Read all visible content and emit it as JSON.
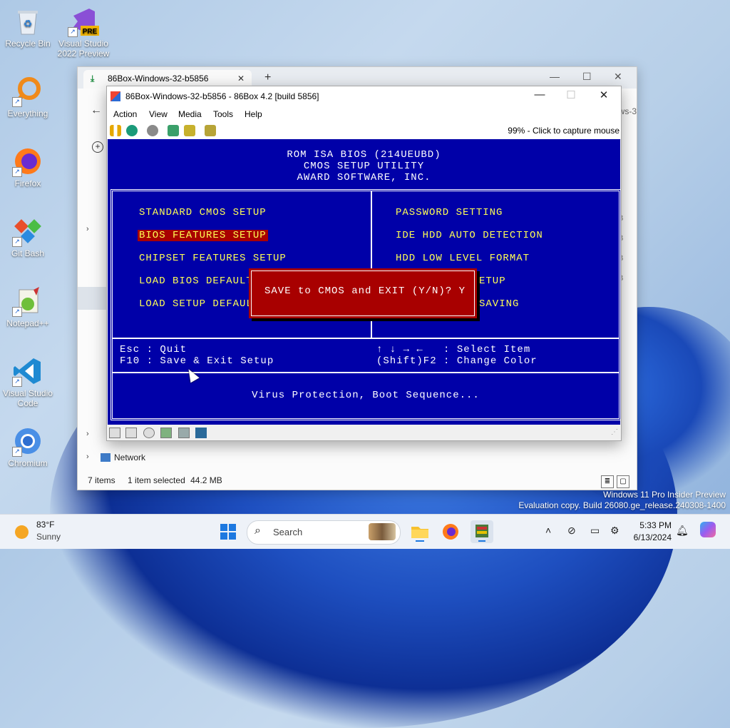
{
  "desktop": {
    "icons": [
      {
        "label": "Recycle Bin"
      },
      {
        "label": "Visual Studio 2022 Preview",
        "badge": "PRE"
      },
      {
        "label": "Everything"
      },
      {
        "label": "Firefox"
      },
      {
        "label": "Git Bash"
      },
      {
        "label": "Notepad++"
      },
      {
        "label": "Visual Studio Code"
      },
      {
        "label": "Chromium"
      }
    ],
    "watermark_line1": "Windows 11 Pro Insider Preview",
    "watermark_line2": "Evaluation copy. Build 26080.ge_release.240308-1400"
  },
  "explorer": {
    "tab_title": "86Box-Windows-32-b5856",
    "right_fragment": "ws-3",
    "network_label": "Network",
    "status_items": "7 items",
    "status_selected": "1 item selected",
    "status_size": "44.2 MB",
    "size_col": [
      "B",
      "B",
      "B",
      "B"
    ]
  },
  "box86": {
    "title": "86Box-Windows-32-b5856 - 86Box 4.2 [build 5856]",
    "menu": [
      "Action",
      "View",
      "Media",
      "Tools",
      "Help"
    ],
    "capture_hint": "99% - Click to capture mouse",
    "bios": {
      "header": [
        "ROM ISA BIOS (214UEUBD)",
        "CMOS SETUP UTILITY",
        "AWARD SOFTWARE, INC."
      ],
      "left_items": [
        "STANDARD CMOS SETUP",
        "BIOS FEATURES SETUP",
        "CHIPSET FEATURES SETUP",
        "LOAD BIOS DEFAULT",
        "LOAD SETUP DEFAUL"
      ],
      "right_items": [
        "PASSWORD SETTING",
        "IDE HDD AUTO DETECTION",
        "HDD LOW LEVEL FORMAT",
        "ETUP",
        "SAVING"
      ],
      "selected_item": "BIOS FEATURES SETUP",
      "dialog": "SAVE to CMOS and EXIT (Y/N)? Y",
      "help_left": [
        "Esc : Quit",
        "F10 : Save & Exit Setup"
      ],
      "help_right": [
        "↑ ↓ → ←   : Select Item",
        "(Shift)F2 : Change Color"
      ],
      "description": "Virus Protection, Boot Sequence...",
      "colors": {
        "background": "#0000a8",
        "item": "#ffff54",
        "highlight": "#a80000"
      }
    }
  },
  "taskbar": {
    "temperature": "83°F",
    "condition": "Sunny",
    "search_placeholder": "Search",
    "time": "5:33 PM",
    "date": "6/13/2024",
    "tray_icons": [
      "chevron-up-icon",
      "network-off-icon",
      "display-icon",
      "settings-icon",
      "bell-icon"
    ]
  }
}
